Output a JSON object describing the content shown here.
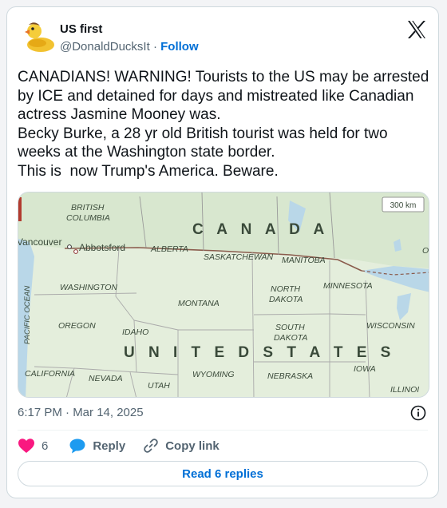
{
  "tweet": {
    "author": {
      "display_name": "US first",
      "handle": "@DonaldDucksIt",
      "separator": "·",
      "follow_label": "Follow"
    },
    "text": "CANADIANS! WARNING! Tourists to the US may be arrested by ICE and detained for days and mistreated like Canadian actress Jasmine Mooney was.\nBecky Burke, a 28 yr old British tourist was held for two weeks at the Washington state border.\nThis is  now Trump's America. Beware.",
    "timestamp": "6:17 PM · Mar 14, 2025",
    "likes": {
      "count": "6"
    },
    "reply_label": "Reply",
    "copy_link_label": "Copy link",
    "read_replies_label": "Read 6 replies"
  },
  "map": {
    "scale_label": "300 km",
    "country_canada": "C A N A D A",
    "country_us": "U N I T E D   S T A T E S",
    "ocean": "PACIFIC OCEAN",
    "cities": {
      "vancouver": "Vancouver",
      "abbotsford": "Abbotsford"
    },
    "provinces": {
      "bc_line1": "BRITISH",
      "bc_line2": "COLUMBIA",
      "alberta": "ALBERTA",
      "saskatchewan": "SASKATCHEWAN",
      "manitoba": "MANITOBA",
      "ontario_partial": "O"
    },
    "states": {
      "washington": "WASHINGTON",
      "oregon": "OREGON",
      "idaho": "IDAHO",
      "montana": "MONTANA",
      "north_dakota_1": "NORTH",
      "north_dakota_2": "DAKOTA",
      "south_dakota_1": "SOUTH",
      "south_dakota_2": "DAKOTA",
      "minnesota": "MINNESOTA",
      "wisconsin": "WISCONSIN",
      "california": "CALIFORNIA",
      "nevada": "NEVADA",
      "utah": "UTAH",
      "wyoming": "WYOMING",
      "nebraska": "NEBRASKA",
      "iowa": "IOWA",
      "illinois": "ILLINOI"
    }
  },
  "colors": {
    "like": "#f91880",
    "reply": "#1d9bf0",
    "link": "#006fd6",
    "canada_land": "#d8e7cf",
    "us_land": "#e4eedc",
    "water": "#b9d7e8"
  },
  "icons": {
    "brand": "x-logo-icon",
    "info": "info-icon",
    "like": "heart-icon",
    "reply": "speech-bubble-icon",
    "copy": "link-icon",
    "avatar": "rubber-duck-avatar"
  }
}
